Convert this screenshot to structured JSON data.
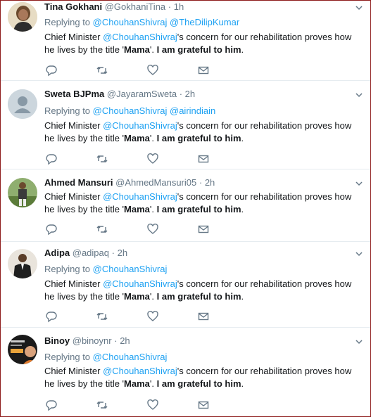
{
  "tweets": [
    {
      "name": "Tina Gokhani",
      "handle": "@GokhaniTina",
      "time": "1h",
      "replying_label": "Replying to",
      "replying_to": [
        "@ChouhanShivraj",
        "@TheDilipKumar"
      ],
      "text_1": "Chief Minister ",
      "mention": "@ChouhanShivraj",
      "text_2": "'s concern for our rehabilitation proves how he lives by the title '",
      "bold_1": "Mama",
      "text_3": "'. ",
      "bold_2": "I am grateful to him",
      "text_4": ".",
      "avatar": "woman-photo"
    },
    {
      "name": "Sweta BJPma",
      "handle": "@JayaramSweta",
      "time": "2h",
      "replying_label": "Replying to",
      "replying_to": [
        "@ChouhanShivraj",
        "@airindiain"
      ],
      "text_1": "Chief Minister ",
      "mention": "@ChouhanShivraj",
      "text_2": "'s concern for our rehabilitation proves how he lives by the title '",
      "bold_1": "Mama",
      "text_3": "'. ",
      "bold_2": "I am grateful to him",
      "text_4": ".",
      "avatar": "default-egg"
    },
    {
      "name": "Ahmed Mansuri",
      "handle": "@AhmedMansuri05",
      "time": "2h",
      "replying_label": "Replying to",
      "replying_to": [
        "@ChouhanShivraj"
      ],
      "text_1": "Chief Minister ",
      "mention": "@ChouhanShivraj",
      "text_2": "'s concern for our rehabilitation proves how he lives by the title '",
      "bold_1": "Mama",
      "text_3": "'. ",
      "bold_2": "I am grateful to him",
      "text_4": ".",
      "avatar": "man-field-photo"
    },
    {
      "name": "Adipa",
      "handle": "@adipaq",
      "time": "2h",
      "replying_label": "Replying to",
      "replying_to": [
        "@ChouhanShivraj"
      ],
      "text_1": "Chief Minister ",
      "mention": "@ChouhanShivraj",
      "text_2": "'s concern for our rehabilitation proves how he lives by the title '",
      "bold_1": "Mama",
      "text_3": "'. ",
      "bold_2": "I am grateful to him",
      "text_4": ".",
      "avatar": "man-suit-photo"
    },
    {
      "name": "Binoy",
      "handle": "@binoynr",
      "time": "2h",
      "replying_label": "Replying to",
      "replying_to": [
        "@ChouhanShivraj"
      ],
      "text_1": "Chief Minister ",
      "mention": "@ChouhanShivraj",
      "text_2": "'s concern for our rehabilitation proves how he lives by the title '",
      "bold_1": "Mama",
      "text_3": "'. ",
      "bold_2": "I am grateful to him",
      "text_4": ".",
      "avatar": "poster-photo"
    }
  ],
  "icons": {
    "reply": "reply-icon",
    "retweet": "retweet-icon",
    "like": "heart-icon",
    "dm": "envelope-icon",
    "caret": "chevron-down-icon"
  },
  "colors": {
    "link": "#1da1f2",
    "secondary": "#657786",
    "text": "#14171a",
    "frame": "#8e1b1b"
  }
}
